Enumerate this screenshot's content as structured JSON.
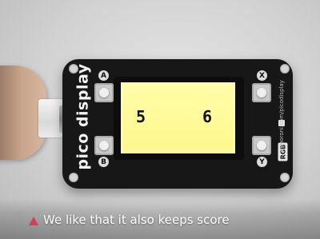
{
  "board": {
    "brand": "pico display",
    "url": "pimoroni.com/picodisplay",
    "rgb_label": "RGB",
    "buttons": {
      "a": "A",
      "b": "B",
      "x": "X",
      "y": "Y"
    }
  },
  "screen": {
    "score_left": "5",
    "score_right": "6"
  },
  "caption": {
    "text": "We like that it also keeps score",
    "marker_color": "#d63a5c"
  }
}
